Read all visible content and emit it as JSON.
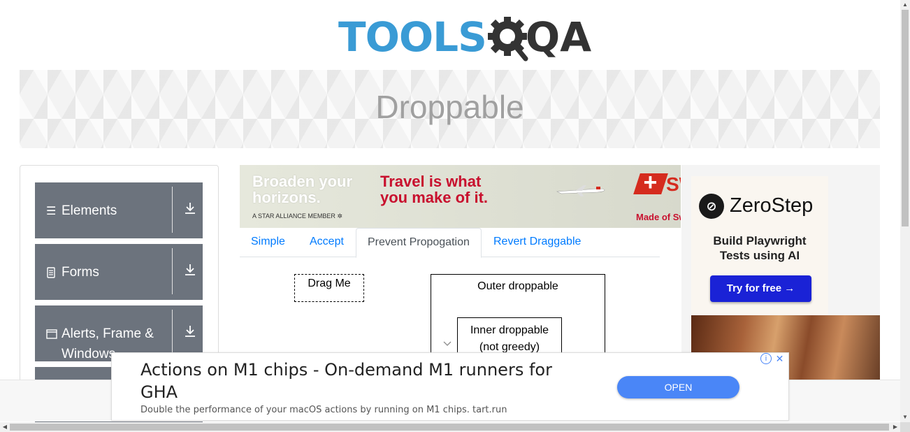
{
  "header": {
    "logo_tools": "TOOLS",
    "logo_qa": "QA"
  },
  "banner": {
    "title": "Droppable"
  },
  "sidebar": {
    "groups": [
      {
        "label": "Elements",
        "icon": "hamburger-icon"
      },
      {
        "label": "Forms",
        "icon": "document-icon"
      },
      {
        "label": "Alerts, Frame & Windows",
        "icon": "window-icon"
      }
    ]
  },
  "ad_top": {
    "headline": "Broaden your horizons.",
    "tagline": "Travel is what you make of it.",
    "member": "A STAR ALLIANCE MEMBER",
    "brand_fragment": "SW",
    "made": "Made of Sw"
  },
  "tabs": [
    {
      "label": "Simple",
      "active": false
    },
    {
      "label": "Accept",
      "active": false
    },
    {
      "label": "Prevent Propogation",
      "active": true
    },
    {
      "label": "Revert Draggable",
      "active": false
    }
  ],
  "content": {
    "drag_me": "Drag Me",
    "outer_droppable": "Outer droppable",
    "inner_droppable_line1": "Inner droppable",
    "inner_droppable_line2": "(not greedy)"
  },
  "ad_right": {
    "brand": "ZeroStep",
    "text_line1": "Build Playwright",
    "text_line2": "Tests using AI",
    "cta": "Try for free →"
  },
  "ad_bottom": {
    "title": "Actions on M1 chips - On-demand M1 runners for GHA",
    "description": "Double the performance of your macOS actions by running on M1 chips. tart.run",
    "open_label": "OPEN"
  },
  "colors": {
    "logo_blue": "#3a9bd5",
    "sidebar_group": "#6c737d",
    "tab_link": "#007bff",
    "cta_blue": "#1a22d6",
    "open_button": "#4a86f7"
  }
}
